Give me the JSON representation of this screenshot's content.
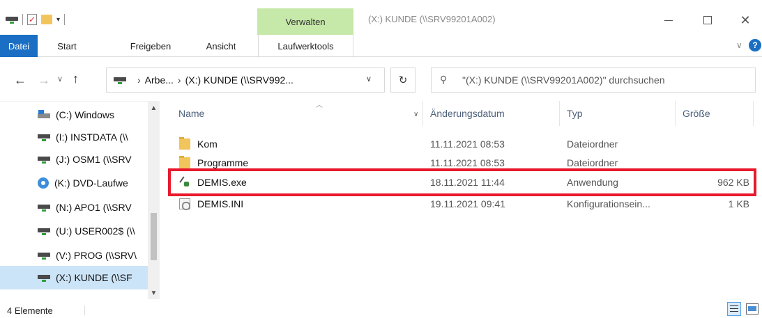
{
  "titlebar": {
    "context_tab": "Verwalten",
    "title": "(X:) KUNDE (\\\\SRV99201A002)",
    "minimize_icon": "minimize-icon",
    "maximize_icon": "maximize-icon",
    "close_icon": "close-icon"
  },
  "ribbon": {
    "tabs": [
      "Datei",
      "Start",
      "Freigeben",
      "Ansicht",
      "Laufwerktools"
    ],
    "active_file_color": "#1a6fc4",
    "context_color": "#c6e8a8"
  },
  "navigation": {
    "address_crumbs": [
      "Arbe...",
      "(X:) KUNDE (\\\\SRV992..."
    ],
    "search_placeholder": "\"(X:) KUNDE (\\\\SRV99201A002)\" durchsuchen"
  },
  "tree": {
    "items": [
      {
        "label": "(C:) Windows",
        "icon": "windows-drive-icon",
        "selected": false
      },
      {
        "label": "(I:) INSTDATA (\\\\",
        "icon": "network-drive-icon",
        "selected": false
      },
      {
        "label": "(J:) OSM1 (\\\\SRV",
        "icon": "network-drive-icon",
        "selected": false
      },
      {
        "label": "(K:) DVD-Laufwe",
        "icon": "dvd-drive-icon",
        "selected": false
      },
      {
        "label": "(N:) APO1 (\\\\SRV",
        "icon": "network-drive-icon",
        "selected": false
      },
      {
        "label": "(U:) USER002$ (\\\\",
        "icon": "network-drive-icon",
        "selected": false
      },
      {
        "label": "(V:) PROG (\\\\SRV\\",
        "icon": "network-drive-icon",
        "selected": false
      },
      {
        "label": "(X:) KUNDE (\\\\SF",
        "icon": "network-drive-icon",
        "selected": true
      }
    ]
  },
  "filelist": {
    "columns": {
      "name": "Name",
      "date": "Änderungsdatum",
      "type": "Typ",
      "size": "Größe"
    },
    "rows": [
      {
        "name": "Kom",
        "date": "11.11.2021 08:53",
        "type": "Dateiordner",
        "size": "",
        "icon": "folder-icon"
      },
      {
        "name": "Programme",
        "date": "11.11.2021 08:53",
        "type": "Dateiordner",
        "size": "",
        "icon": "folder-icon"
      },
      {
        "name": "DEMIS.exe",
        "date": "18.11.2021 11:44",
        "type": "Anwendung",
        "size": "962 KB",
        "icon": "exe-icon"
      },
      {
        "name": "DEMIS.INI",
        "date": "19.11.2021 09:41",
        "type": "Konfigurationsein...",
        "size": "1 KB",
        "icon": "ini-file-icon"
      }
    ],
    "highlight_color": "#e8192c"
  },
  "status": {
    "count": "4 Elemente"
  }
}
